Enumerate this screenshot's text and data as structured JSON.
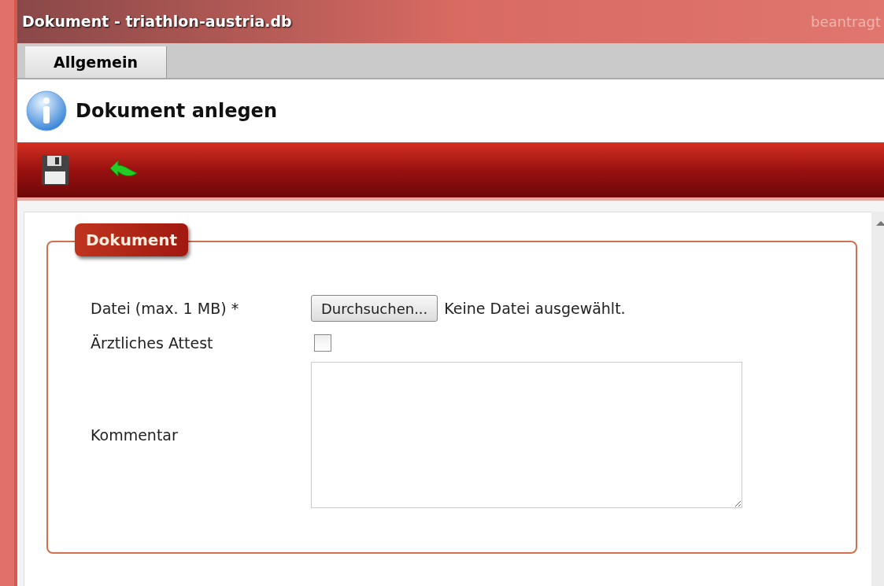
{
  "window": {
    "title": "Dokument - triathlon-austria.db",
    "background_text": "beantragt"
  },
  "tabs": [
    {
      "label": "Allgemein",
      "selected": true
    }
  ],
  "header": {
    "title": "Dokument anlegen"
  },
  "fieldset": {
    "legend": "Dokument",
    "rows": [
      {
        "kind": "file",
        "label": "Datei (max. 1 MB) *",
        "button": "Durchsuchen...",
        "status": "Keine Datei ausgewählt."
      },
      {
        "kind": "checkbox",
        "label": "Ärztliches Attest",
        "checked": false
      },
      {
        "kind": "textarea",
        "label": "Kommentar"
      }
    ]
  }
}
